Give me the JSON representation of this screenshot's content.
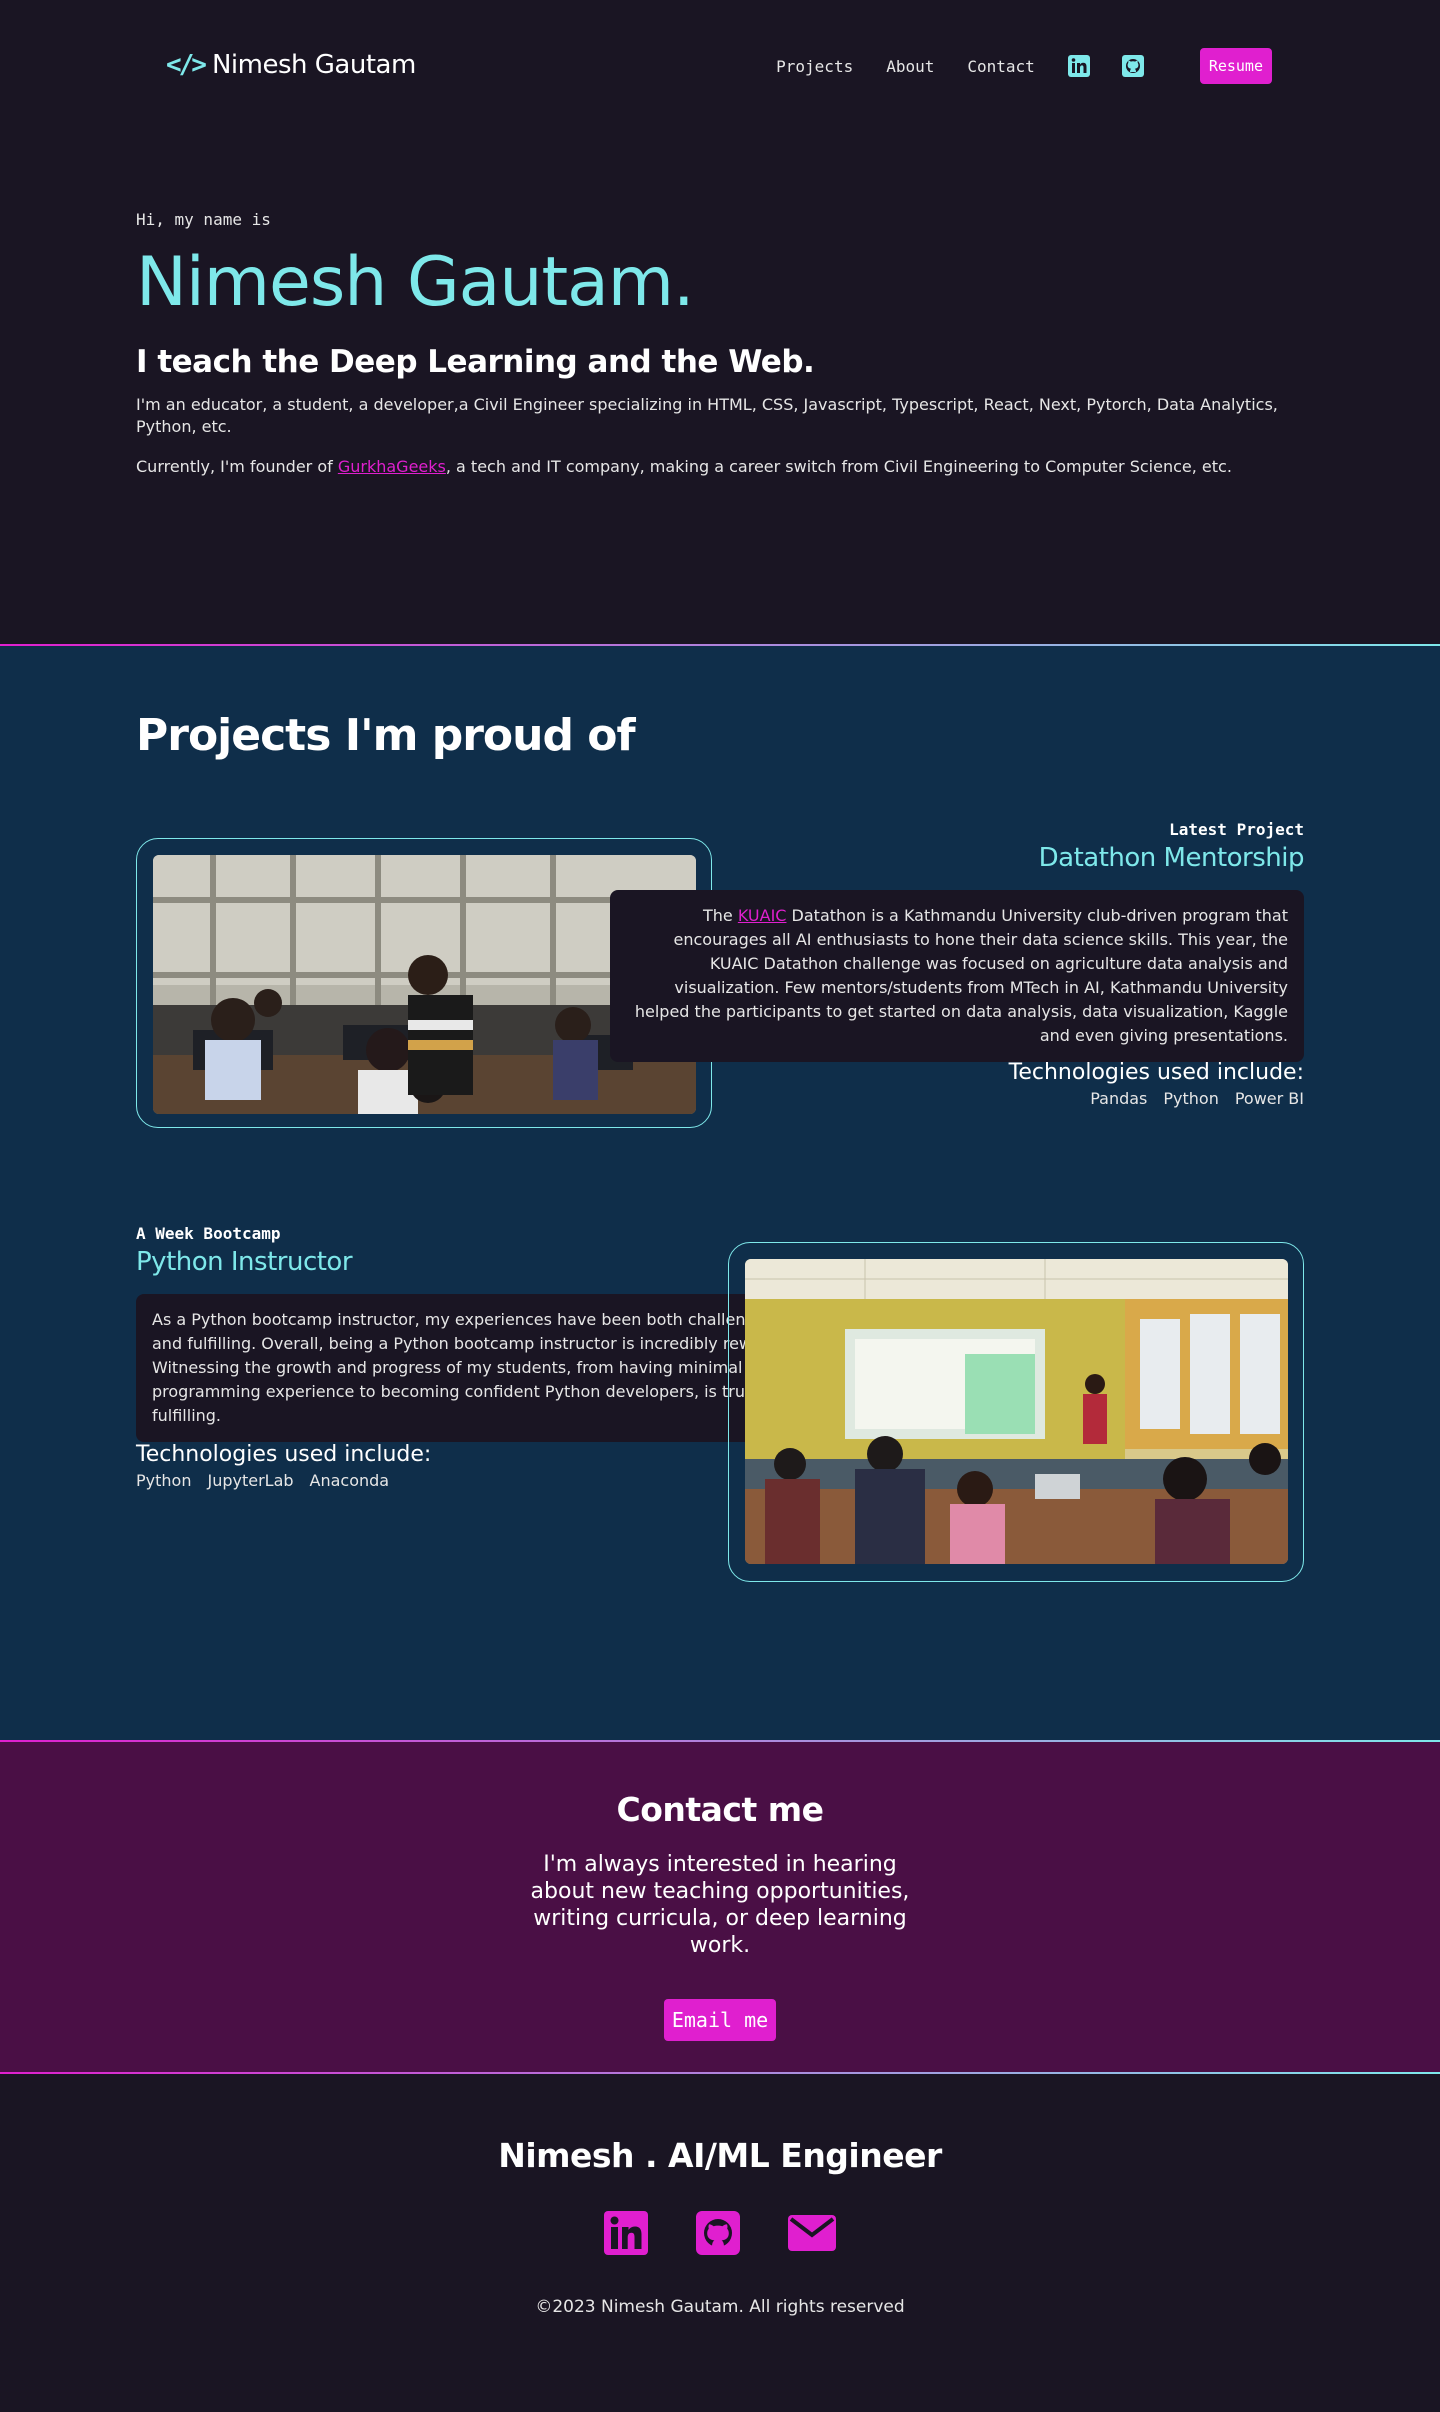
{
  "nav": {
    "logo_icon": "</>",
    "logo_text": "Nimesh Gautam",
    "links": [
      "Projects",
      "About",
      "Contact"
    ],
    "icons": [
      "linkedin-icon",
      "github-icon"
    ],
    "resume_label": "Resume"
  },
  "hero": {
    "greeting": "Hi, my name is",
    "name": "Nimesh Gautam.",
    "tagline": "I teach the Deep Learning and the Web.",
    "intro": "I'm an educator, a student, a developer,a Civil Engineer specializing in HTML, CSS, Javascript, Typescript, React, Next, Pytorch, Data Analytics, Python, etc.",
    "founder_prefix": "Currently, I'm founder of ",
    "founder_link": "GurkhaGeeks",
    "founder_suffix": ", a tech and IT company, making a career switch from Civil Engineering to Computer Science, etc."
  },
  "projects": {
    "title": "Projects I'm proud of",
    "items": [
      {
        "kicker": "Latest Project",
        "title": "Datathon Mentorship",
        "desc_prefix": "The ",
        "desc_link": "KUAIC",
        "desc_body": " Datathon is a Kathmandu University club-driven program that encourages all AI enthusiasts to hone their data science skills. This year, the KUAIC Datathon challenge was focused on agriculture data analysis and visualization. Few mentors/students from MTech in AI, Kathmandu University helped the participants to get started on data analysis, data visualization, Kaggle and even giving presentations.",
        "tech_heading": "Technologies used include:",
        "tech": [
          "Pandas",
          "Python",
          "Power BI"
        ]
      },
      {
        "kicker": "A Week Bootcamp",
        "title": "Python Instructor",
        "desc_body": "As a Python bootcamp instructor, my experiences have been both challenging and fulfilling. Overall, being a Python bootcamp instructor is incredibly rewarding. Witnessing the growth and progress of my students, from having minimal programming experience to becoming confident Python developers, is truly fulfilling.",
        "tech_heading": "Technologies used include:",
        "tech": [
          "Python",
          "JupyterLab",
          "Anaconda"
        ]
      }
    ]
  },
  "contact": {
    "title": "Contact me",
    "text": "I'm always interested in hearing about new teaching opportunities, writing curricula, or deep learning work.",
    "button": "Email me"
  },
  "footer": {
    "title": "Nimesh . AI/ML Engineer",
    "icons": [
      "linkedin-icon",
      "github-icon",
      "mail-icon"
    ],
    "copyright": "©2023 Nimesh Gautam. All rights reserved"
  },
  "colors": {
    "background": "#1a1523",
    "accent_cyan": "#7ee8ea",
    "accent_pink": "#e01fcf",
    "projects_bg": "#0f2e4a",
    "contact_bg": "#4a0f45"
  }
}
